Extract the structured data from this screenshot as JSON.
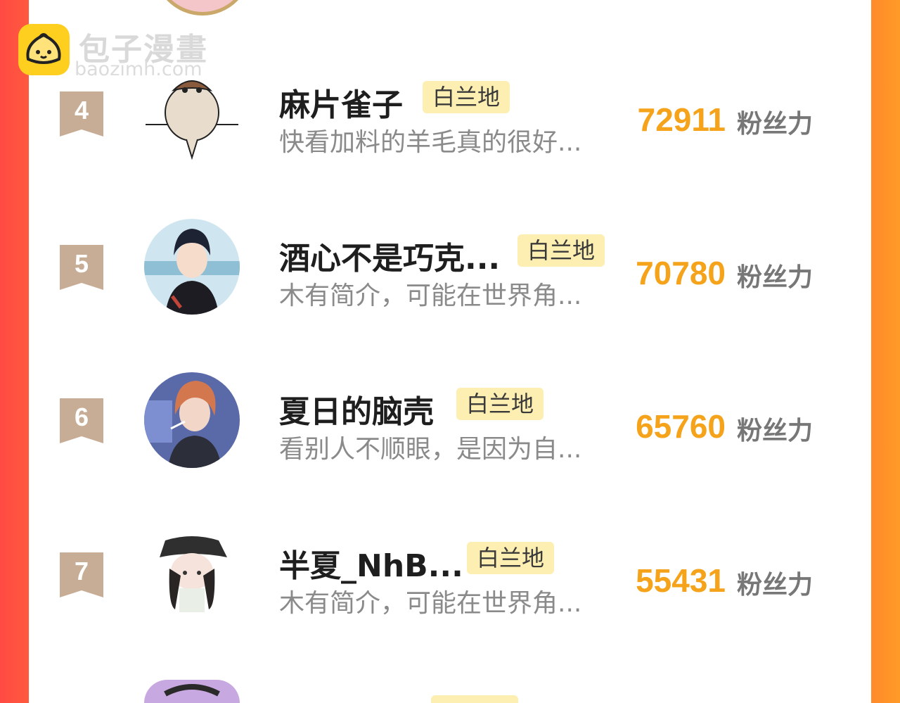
{
  "watermark": {
    "title": "包子漫畫",
    "url": "baozimh.com"
  },
  "colors": {
    "accent": "#f5a31a",
    "tag_bg": "#fdeeb1",
    "rank_badge": "#c8ad96"
  },
  "ranking": {
    "fans_label": "粉丝力",
    "rows": [
      {
        "rank": "4",
        "name": "麻片雀子",
        "tag": "白兰地",
        "desc": "快看加料的羊毛真的很好...",
        "fans": "72911"
      },
      {
        "rank": "5",
        "name": "酒心不是巧克...",
        "tag": "白兰地",
        "desc": "木有简介，可能在世界角...",
        "fans": "70780"
      },
      {
        "rank": "6",
        "name": "夏日的脑壳",
        "tag": "白兰地",
        "desc": "看别人不顺眼，是因为自...",
        "fans": "65760"
      },
      {
        "rank": "7",
        "name": "半夏_NhB...",
        "tag": "白兰地",
        "desc": "木有简介，可能在世界角...",
        "fans": "55431"
      }
    ]
  }
}
